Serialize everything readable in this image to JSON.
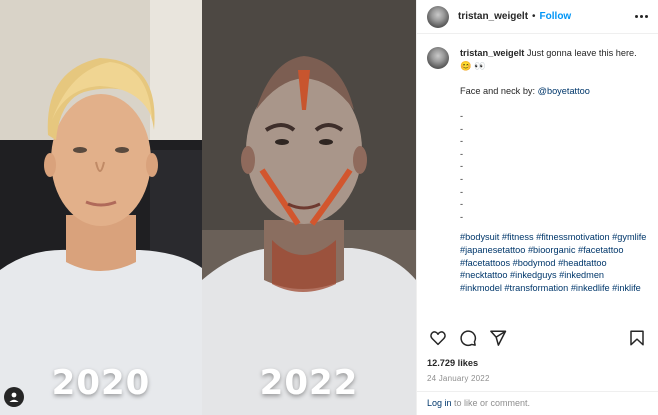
{
  "post": {
    "username": "tristan_weigelt",
    "follow_label": "Follow",
    "separator": "•",
    "images": {
      "left_year": "2020",
      "right_year": "2022"
    },
    "caption": {
      "username": "tristan_weigelt",
      "text": "Just gonna leave this here. 😊 👀",
      "credit_prefix": "Face and neck by: ",
      "credit_handle": "@boyetattoo",
      "dashes": [
        "-",
        "-",
        "-",
        "-",
        "-",
        "-",
        "-",
        "-",
        "-"
      ],
      "hashtags": "#bodysuit #fitness #fitnessmotivation #gymlife #japanesetattoo #bioorganic #facetattoo #facetattoos #bodymod #headtattoo #necktattoo #inkedguys #inkedmen #inkmodel #transformation #inkedlife #inklife"
    },
    "likes": "12.729 likes",
    "date": "24 January 2022",
    "login_link": "Log in",
    "login_text": " to like or comment."
  },
  "icons": [
    "more-icon",
    "heart-icon",
    "comment-icon",
    "share-icon",
    "save-icon",
    "user-icon"
  ],
  "colors": {
    "accent": "#0095f6",
    "link": "#00376b",
    "text": "#262626",
    "muted": "#8e8e8e"
  }
}
